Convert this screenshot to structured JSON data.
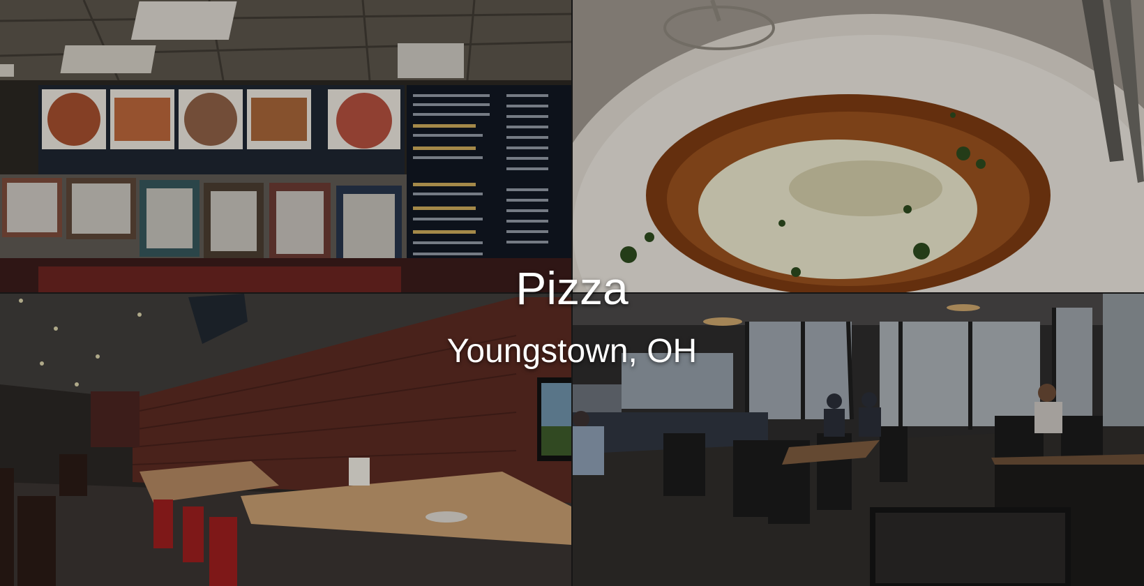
{
  "overlay": {
    "title": "Pizza",
    "subtitle": "Youngstown, OH"
  },
  "photos": [
    {
      "subject": "menu-board-and-framed-certificates"
    },
    {
      "subject": "pizza-soup-bowl-closeup"
    },
    {
      "subject": "brick-wall-dining-room"
    },
    {
      "subject": "dining-room-with-windows"
    }
  ],
  "colors": {
    "title_text": "#ffffff",
    "background": "#1b1b1b"
  }
}
